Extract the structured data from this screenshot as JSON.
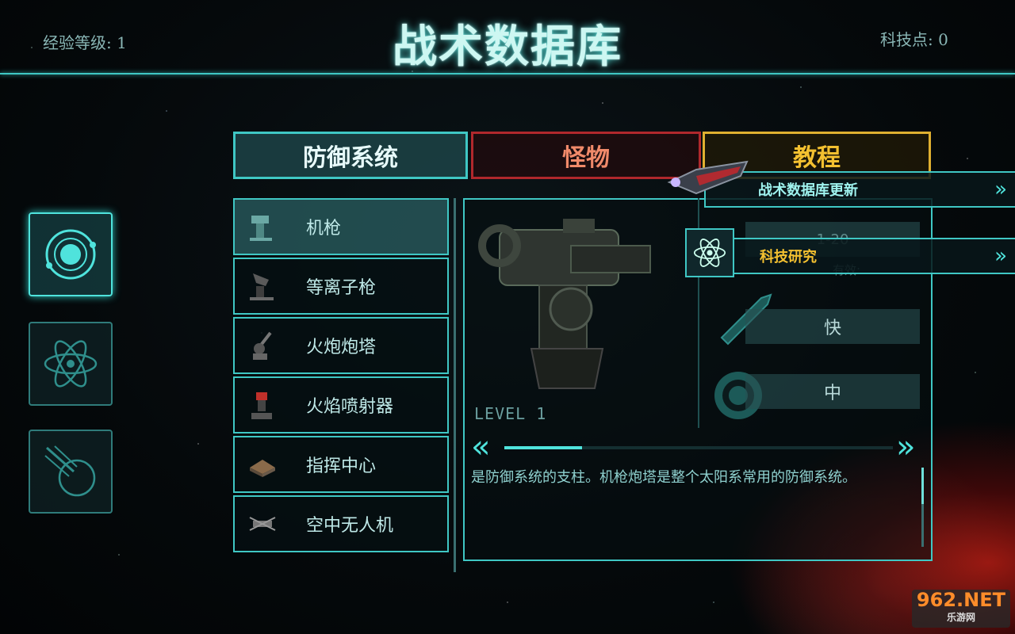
{
  "header": {
    "exp_label": "经验等级: 1",
    "title": "战术数据库",
    "tech_points": "科技点: 0"
  },
  "side_buttons": [
    {
      "icon": "orbit-icon",
      "active": true
    },
    {
      "icon": "atom-icon",
      "active": false
    },
    {
      "icon": "meteor-icon",
      "active": false
    }
  ],
  "tabs": {
    "defense": "防御系统",
    "monsters": "怪物",
    "tutorial": "教程"
  },
  "items": [
    {
      "label": "机枪",
      "icon": "machine-gun-icon"
    },
    {
      "label": "等离子枪",
      "icon": "plasma-gun-icon"
    },
    {
      "label": "火炮炮塔",
      "icon": "artillery-turret-icon"
    },
    {
      "label": "火焰喷射器",
      "icon": "flamethrower-icon"
    },
    {
      "label": "指挥中心",
      "icon": "command-center-icon"
    },
    {
      "label": "空中无人机",
      "icon": "air-drone-icon"
    }
  ],
  "detail": {
    "level": "LEVEL 1",
    "range_value": "1-20",
    "effective_label": "有效:",
    "speed_value": "快",
    "accuracy_value": "中",
    "description": "是防御系统的支柱。机枪炮塔是整个太阳系常用的防御系统。",
    "progress": 0.2
  },
  "popups": {
    "update": "战术数据库更新",
    "research": "科技研究"
  },
  "watermark": {
    "brand": "962.NET",
    "sub": "乐游网"
  },
  "colors": {
    "accent": "#3fc7c4",
    "monster_tab": "#b0282c",
    "tutorial_tab": "#e0b030"
  }
}
